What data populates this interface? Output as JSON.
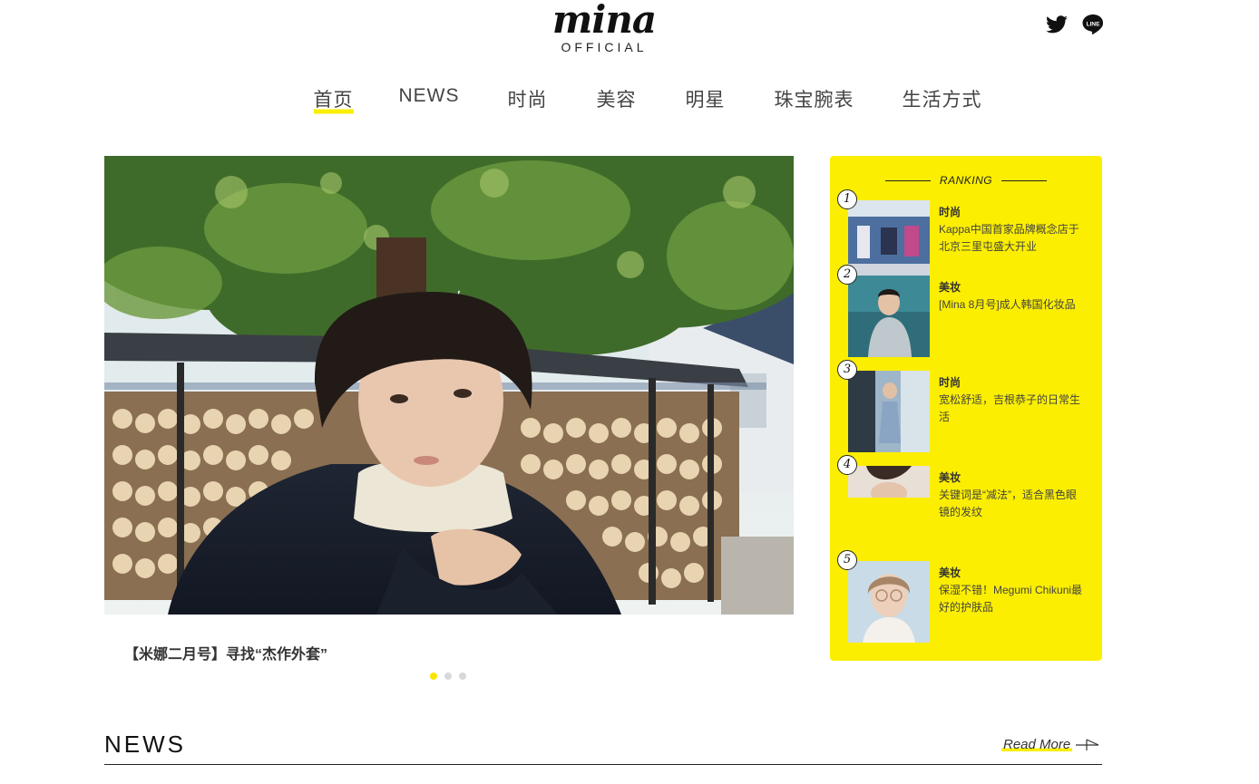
{
  "header": {
    "logo_word": "mina",
    "logo_sub": "OFFICIAL",
    "social": [
      {
        "name": "twitter-icon"
      },
      {
        "name": "line-icon",
        "label": "LINE"
      }
    ]
  },
  "nav": {
    "items": [
      {
        "label": "首页",
        "active": true
      },
      {
        "label": "NEWS"
      },
      {
        "label": "时尚"
      },
      {
        "label": "美容"
      },
      {
        "label": "明星"
      },
      {
        "label": "珠宝腕表"
      },
      {
        "label": "生活方式"
      }
    ]
  },
  "hero": {
    "caption": "【米娜二月号】寻找“杰作外套”",
    "slides_total": 3,
    "slide_active": 1
  },
  "ranking": {
    "title": "RANKING",
    "items": [
      {
        "num": "1",
        "category": "时尚",
        "text": "Kappa中国首家品牌概念店于北京三里屯盛大开业"
      },
      {
        "num": "2",
        "category": "美妆",
        "text": "[Mina 8月号]成人韩国化妆品"
      },
      {
        "num": "3",
        "category": "时尚",
        "text": "宽松舒适，吉根恭子的日常生活"
      },
      {
        "num": "4",
        "category": "美妆",
        "text": "关键词是“减法”，适合黑色眼镜的发纹"
      },
      {
        "num": "5",
        "category": "美妆",
        "text": "保湿不错！Megumi Chikuni最好的护肤品"
      }
    ]
  },
  "news": {
    "title": "NEWS",
    "read_more": "Read More"
  },
  "colors": {
    "accent": "#fbee00",
    "text": "#333333"
  }
}
